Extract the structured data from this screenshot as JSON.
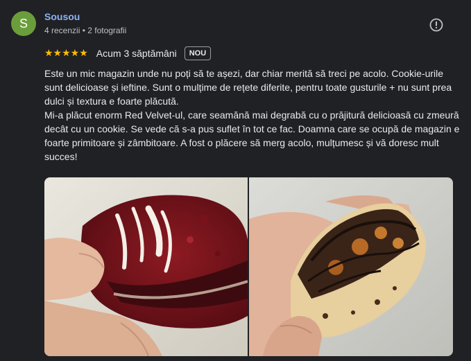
{
  "author": {
    "initial": "S",
    "name": "Sousou",
    "meta": "4 recenzii • 2 fotografii"
  },
  "rating": {
    "stars": 5,
    "stars_display": "★★★★★",
    "date": "Acum 3 săptămâni",
    "badge": "NOU"
  },
  "review": {
    "text": "Este un mic magazin unde nu poți să te așezi, dar chiar merită să treci pe acolo. Cookie-urile sunt delicioase și ieftine. Sunt o mulțime de rețete diferite, pentru toate gusturile + nu sunt prea dulci și textura e foarte plăcută.\nMi-a plăcut enorm Red Velvet-ul, care seamănă mai degrabă cu o prăjitură delicioasă cu zmeură decât cu un cookie. Se vede că s-a pus suflet în tot ce fac. Doamna care se ocupă de magazin e foarte primitoare și zâmbitoare. A fost o plăcere să merg acolo, mulțumesc și vă doresc mult succes!"
  },
  "colors": {
    "avatar": "#6a9e3b",
    "author_name": "#8ab4f8",
    "stars": "#fbbc04",
    "background": "#202124"
  },
  "photos": [
    {
      "icon": "red-velvet-cookie-photo"
    },
    {
      "icon": "chocolate-caramel-cookie-photo"
    }
  ]
}
